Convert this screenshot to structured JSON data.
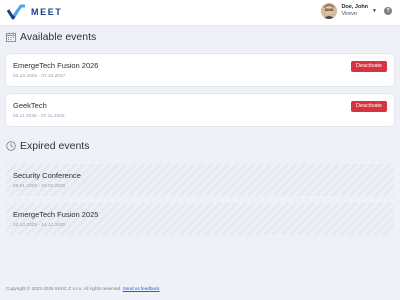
{
  "header": {
    "logo_text": "MEET",
    "user_name": "Doe, John",
    "user_org": "Virevo",
    "help_label": "?"
  },
  "available": {
    "title": "Available events",
    "events": [
      {
        "name": "EmergeTech Fusion 2026",
        "dates": "03.10.2026 - 07.10.2027",
        "action": "Deactivate"
      },
      {
        "name": "GeekTech",
        "dates": "05.11.2026 - 07.11.2026",
        "action": "Deactivate"
      }
    ]
  },
  "expired": {
    "title": "Expired events",
    "events": [
      {
        "name": "Security Conference",
        "dates": "29.01.2026 - 29.01.2026"
      },
      {
        "name": "EmergeTech Fusion 2025",
        "dates": "12.12.2025 - 14.12.2025"
      }
    ]
  },
  "footer": {
    "copyright": "Copyright © 2022-2026 INXIC.Z s.r.o. All rights reserved.",
    "feedback_link": "Send us feedback"
  },
  "colors": {
    "brand": "#1d3f8a",
    "logo_accent": "#4aa8e0",
    "danger": "#d63340",
    "background": "#eef1f6"
  },
  "icons": {
    "logo": "checkmark-logo-icon",
    "available": "calendar-icon",
    "expired": "clock-icon",
    "caret": "chevron-down-icon",
    "help": "help-icon"
  }
}
